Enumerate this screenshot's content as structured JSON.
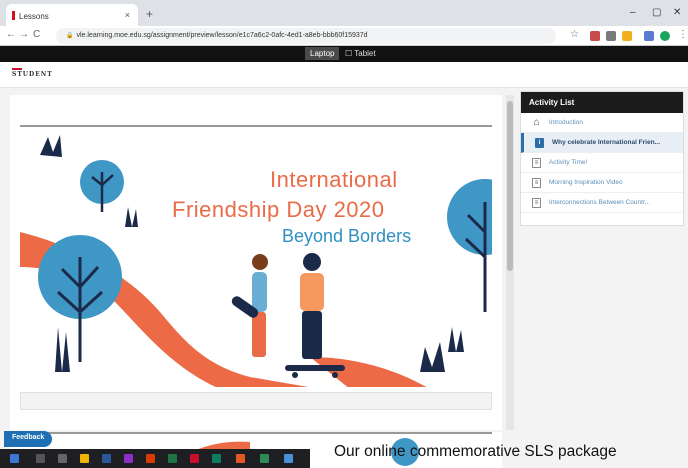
{
  "browser": {
    "tab_title": "Lessons",
    "tab_close": "×",
    "new_tab": "+",
    "minimize": "–",
    "maximize": "▢",
    "close": "✕",
    "url": "vle.learning.moe.edu.sg/assignment/preview/lesson/e1c7a6c2-0afc-4ed1-a8eb-bbb60f15937d",
    "back": "←",
    "forward": "→",
    "reload": "C",
    "lock": "🔒",
    "star": "☆",
    "menu": "⋮"
  },
  "device_toggle": {
    "laptop": "Laptop",
    "tablet": "☐ Tablet"
  },
  "header": {
    "logo_text": "STUDENT"
  },
  "slide": {
    "title_line1": "International",
    "title_line2": "Friendship Day 2020",
    "subtitle": "Beyond Borders"
  },
  "activity_list": {
    "heading": "Activity List",
    "items": [
      {
        "label": "Introduction",
        "icon": "home-icon",
        "glyph": "⌂"
      },
      {
        "label": "Why celebrate International Frien...",
        "icon": "document-icon",
        "glyph": "i"
      },
      {
        "label": "Activity Time!",
        "icon": "document-icon",
        "glyph": "≡"
      },
      {
        "label": "Morning Inspiration Video",
        "icon": "document-icon",
        "glyph": "≡"
      },
      {
        "label": "Interconnections Between Countr...",
        "icon": "document-icon",
        "glyph": "≡"
      }
    ]
  },
  "feedback_label": "Feedback",
  "caption": "Our online commemorative SLS package",
  "colors": {
    "accent_orange": "#ea6b47",
    "accent_blue": "#2f8fc2",
    "active_blue": "#2e6ea8",
    "dark_navy": "#1c2a4a"
  }
}
